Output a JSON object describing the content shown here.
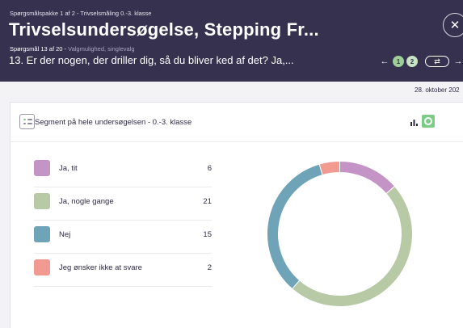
{
  "header": {
    "package_label": "Spørgsmålspakke 1 af 2 - Trivselsmåling 0.-3. klasse",
    "title": "Trivselsundersøgelse, Stepping Fr...",
    "question_count": "Spørgsmål 13 af 20 - ",
    "question_type": "Valgmulighed, singlevalg",
    "question": "13. Er der nogen, der driller dig, så du bliver ked af det? Ja,...",
    "close_glyph": "✕",
    "nav": {
      "prev_glyph": "←",
      "next_glyph": "→",
      "pages": [
        "1",
        "2"
      ],
      "swap_glyph": "⇄"
    }
  },
  "date": "28. oktober 202",
  "card": {
    "segment_label": "Segment på hele undersøgelsen  - 0.-3. klasse",
    "icons": {
      "segment": "segment-list-icon",
      "bars": "bar-chart-icon",
      "pie": "pie-chart-icon"
    }
  },
  "chart_data": {
    "type": "pie",
    "donut": true,
    "categories": [
      "Ja, tit",
      "Ja, nogle gange",
      "Nej",
      "Jeg ønsker ikke at svare"
    ],
    "values": [
      6,
      21,
      15,
      2
    ],
    "colors": [
      "#c594c7",
      "#b8c9a5",
      "#6ea3b8",
      "#f19a91"
    ]
  }
}
